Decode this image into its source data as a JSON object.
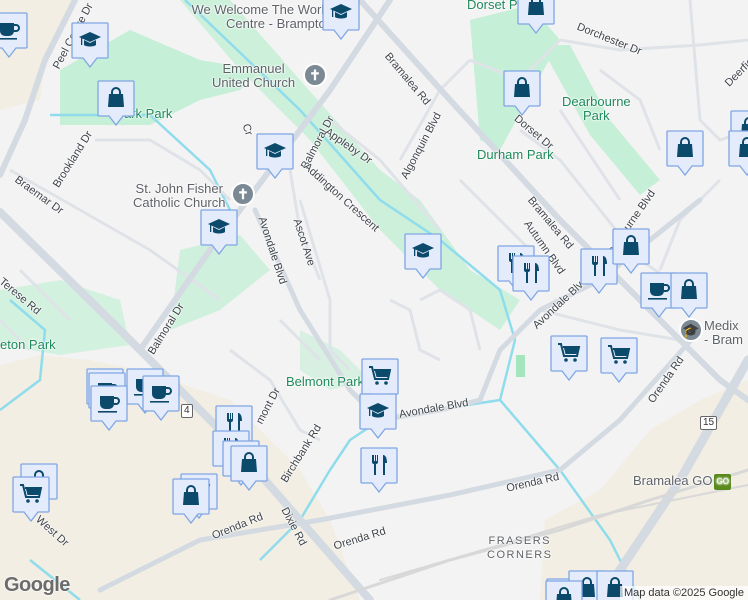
{
  "colors": {
    "background": "#f4f3f4",
    "park": "#c5efd6",
    "commercial": "#f2eee3",
    "road_major": "#d4dae1",
    "road_minor": "#dfe3e8",
    "water": "#8fdcec",
    "marker_fill": "#e4ecfc",
    "marker_border": "#7fa6e3",
    "icon": "#0b4a6b"
  },
  "pois": {
    "welcome_1": "We Welcome The World",
    "welcome_2": "Centre - Brampton",
    "emmanuel_1": "Emmanuel",
    "emmanuel_2": "United Church",
    "fisher_1": "St. John Fisher",
    "fisher_2": "Catholic Church",
    "medix_1": "Medix",
    "medix_2": "- Bram",
    "bramalea_go": "Bramalea GO",
    "go_badge": "GO",
    "frasers_1": "FRASERS",
    "frasers_2": "CORNERS"
  },
  "parks": {
    "dorset": "Dorset Park",
    "dearbourne_1": "Dearbourne",
    "dearbourne_2": "Park",
    "durham": "Durham Park",
    "clark": "ark Park",
    "eton": "eton Park",
    "belmont": "Belmont Park"
  },
  "roads": {
    "peel_centre": "Peel Centre Dr",
    "balmoral_1": "Balmoral Dr",
    "balmoral_2": "Balmoral Dr",
    "appleby": "Appleby Dr",
    "addington": "Addington Crescent",
    "algonquin": "Algonquin Blvd",
    "bramalea_1": "Bramalea Rd",
    "bramalea_2": "Bramalea Rd",
    "autumn": "Autumn Blvd",
    "dearbourne_blvd": "Dearbourne Blvd",
    "dorchester": "Dorchester Dr",
    "dorset_dr": "Dorset Dr",
    "avondale_1": "Avondale Blvd",
    "avondale_2": "Avondale Blvd",
    "avondale_3": "Avondale Blvd",
    "ascot": "Ascot Ave",
    "brookland": "Brookland Dr",
    "braemar": "Braemar Dr",
    "terese": "Terese Rd",
    "birchbank": "Birchbank Rd",
    "belmont_dr": "mont Dr",
    "dixie": "Dixie Rd",
    "orenda_1": "Orenda Rd",
    "orenda_2": "Orenda Rd",
    "orenda_3": "Orenda Rd",
    "orenda_4": "Orenda Rd",
    "west": "West Dr",
    "deerfield": "Deerfie",
    "crawley": "Cr"
  },
  "shields": {
    "hwy4": "4",
    "hwy15": "15"
  },
  "markers": [
    "coffee",
    "graduation-cap",
    "shopping-bag",
    "graduation-cap",
    "shopping-bag",
    "graduation-cap",
    "graduation-cap",
    "shopping-bag",
    "shopping-bag",
    "shopping-bag",
    "shopping-bag",
    "graduation-cap",
    "restaurant",
    "restaurant",
    "restaurant",
    "shopping-bag",
    "coffee",
    "shopping-bag",
    "shopping-cart",
    "shopping-cart",
    "shopping-cart",
    "graduation-cap",
    "restaurant",
    "coffee",
    "coffee",
    "coffee",
    "coffee",
    "coffee",
    "restaurant",
    "restaurant",
    "restaurant",
    "shopping-bag",
    "shopping-bag",
    "shopping-cart",
    "shopping-cart",
    "shopping-bag",
    "coffee",
    "shopping-bag",
    "shopping-bag",
    "shopping-bag"
  ],
  "footer": {
    "logo": "Google",
    "attribution": "Map data ©2025 Google"
  }
}
